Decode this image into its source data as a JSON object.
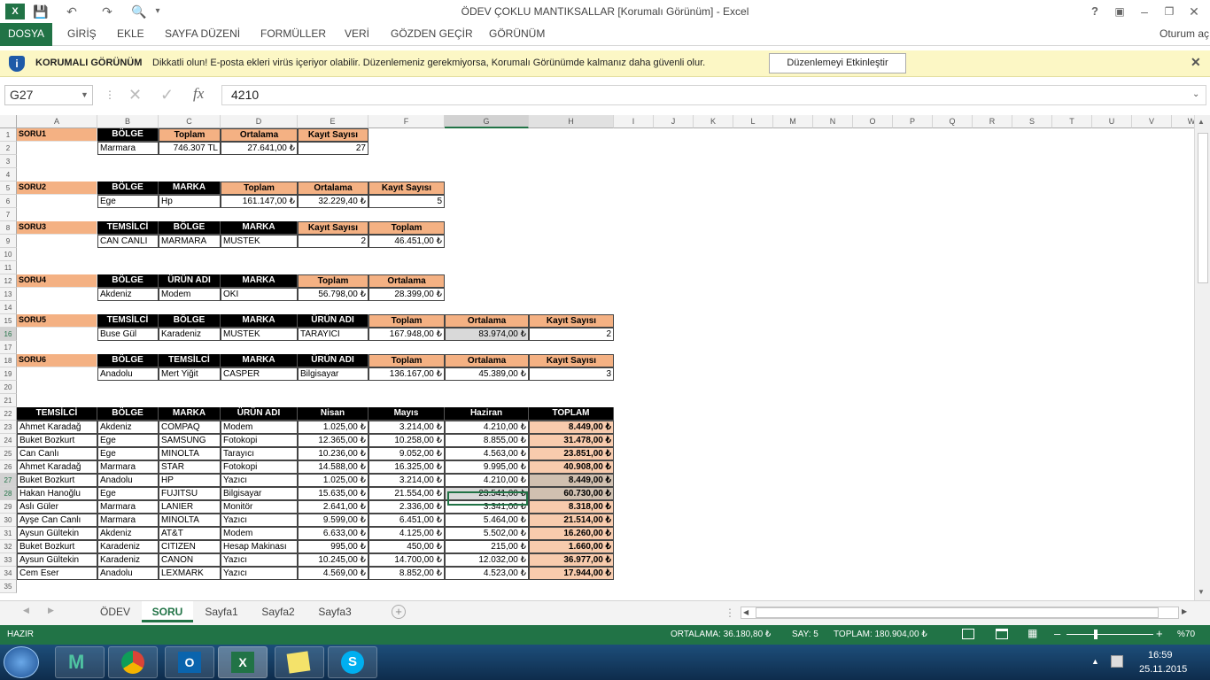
{
  "window": {
    "title": "ÖDEV ÇOKLU MANTIKSALLAR  [Korumalı Görünüm] - Excel",
    "help": "?",
    "signin": "Oturum aç"
  },
  "ribbon": {
    "tabs": [
      "DOSYA",
      "GİRİŞ",
      "EKLE",
      "SAYFA DÜZENİ",
      "FORMÜLLER",
      "VERİ",
      "GÖZDEN GEÇİR",
      "GÖRÜNÜM"
    ]
  },
  "protected": {
    "heading": "KORUMALI GÖRÜNÜM",
    "message": "Dikkatli olun! E-posta ekleri virüs içeriyor olabilir. Düzenlemeniz gerekmiyorsa, Korumalı Görünümde kalmanız daha güvenli olur.",
    "button": "Düzenlemeyi Etkinleştir"
  },
  "formula": {
    "namebox": "G27",
    "value": "4210"
  },
  "columns": [
    "A",
    "B",
    "C",
    "D",
    "E",
    "F",
    "G",
    "H",
    "I",
    "J",
    "K",
    "L",
    "M",
    "N",
    "O",
    "P",
    "Q",
    "R",
    "S",
    "T",
    "U",
    "V",
    "W"
  ],
  "rows": [
    "1",
    "2",
    "3",
    "4",
    "5",
    "6",
    "7",
    "8",
    "9",
    "10",
    "11",
    "12",
    "13",
    "14",
    "15",
    "16",
    "17",
    "18",
    "19",
    "20",
    "21",
    "22",
    "23",
    "24",
    "25",
    "26",
    "27",
    "28",
    "29",
    "30",
    "31",
    "32",
    "33",
    "34",
    "35"
  ],
  "cells": [
    [
      "A1",
      "SORU1",
      "lbl"
    ],
    [
      "B1",
      "BÖLGE",
      "hb"
    ],
    [
      "C1",
      "Toplam",
      "ho"
    ],
    [
      "D1",
      "Ortalama",
      "ho"
    ],
    [
      "E1",
      "Kayıt Sayısı",
      "ho"
    ],
    [
      "B2",
      "Marmara",
      "d"
    ],
    [
      "C2",
      "746.307 TL",
      "d r"
    ],
    [
      "D2",
      "27.641,00 ₺",
      "d r"
    ],
    [
      "E2",
      "27",
      "d r"
    ],
    [
      "A5",
      "SORU2",
      "lbl"
    ],
    [
      "B5",
      "BÖLGE",
      "hb"
    ],
    [
      "C5",
      "MARKA",
      "hb"
    ],
    [
      "D5",
      "Toplam",
      "ho"
    ],
    [
      "E5",
      "Ortalama",
      "ho"
    ],
    [
      "F5",
      "Kayıt Sayısı",
      "ho"
    ],
    [
      "B6",
      "Ege",
      "d"
    ],
    [
      "C6",
      "Hp",
      "d"
    ],
    [
      "D6",
      "161.147,00 ₺",
      "d r"
    ],
    [
      "E6",
      "32.229,40 ₺",
      "d r"
    ],
    [
      "F6",
      "5",
      "d r"
    ],
    [
      "A8",
      "SORU3",
      "lbl"
    ],
    [
      "B8",
      "TEMSİLCİ",
      "hb"
    ],
    [
      "C8",
      "BÖLGE",
      "hb"
    ],
    [
      "D8",
      "MARKA",
      "hb"
    ],
    [
      "E8",
      "Kayıt Sayısı",
      "ho"
    ],
    [
      "F8",
      "Toplam",
      "ho"
    ],
    [
      "B9",
      "CAN CANLI",
      "d"
    ],
    [
      "C9",
      "MARMARA",
      "d"
    ],
    [
      "D9",
      "MUSTEK",
      "d"
    ],
    [
      "E9",
      "2",
      "d r"
    ],
    [
      "F9",
      "46.451,00 ₺",
      "d r"
    ],
    [
      "A12",
      "SORU4",
      "lbl"
    ],
    [
      "B12",
      "BÖLGE",
      "hb"
    ],
    [
      "C12",
      "ÜRÜN ADI",
      "hb"
    ],
    [
      "D12",
      "MARKA",
      "hb"
    ],
    [
      "E12",
      "Toplam",
      "ho"
    ],
    [
      "F12",
      "Ortalama",
      "ho"
    ],
    [
      "B13",
      "Akdeniz",
      "d"
    ],
    [
      "C13",
      "Modem",
      "d"
    ],
    [
      "D13",
      "OKI",
      "d"
    ],
    [
      "E13",
      "56.798,00 ₺",
      "d r"
    ],
    [
      "F13",
      "28.399,00 ₺",
      "d r"
    ],
    [
      "A15",
      "SORU5",
      "lbl"
    ],
    [
      "B15",
      "TEMSİLCİ",
      "hb"
    ],
    [
      "C15",
      "BÖLGE",
      "hb"
    ],
    [
      "D15",
      "MARKA",
      "hb"
    ],
    [
      "E15",
      "ÜRÜN ADI",
      "hb"
    ],
    [
      "F15",
      "Toplam",
      "ho"
    ],
    [
      "G15",
      "Ortalama",
      "ho"
    ],
    [
      "H15",
      "Kayıt Sayısı",
      "ho"
    ],
    [
      "B16",
      "Buse Gül",
      "d"
    ],
    [
      "C16",
      "Karadeniz",
      "d"
    ],
    [
      "D16",
      "MUSTEK",
      "d"
    ],
    [
      "E16",
      "TARAYICI",
      "d"
    ],
    [
      "F16",
      "167.948,00 ₺",
      "d r"
    ],
    [
      "G16",
      "83.974,00 ₺",
      "d r sel"
    ],
    [
      "H16",
      "2",
      "d r"
    ],
    [
      "A18",
      "SORU6",
      "lbl"
    ],
    [
      "B18",
      "BÖLGE",
      "hb"
    ],
    [
      "C18",
      "TEMSİLCİ",
      "hb"
    ],
    [
      "D18",
      "MARKA",
      "hb"
    ],
    [
      "E18",
      "ÜRÜN ADI",
      "hb"
    ],
    [
      "F18",
      "Toplam",
      "ho"
    ],
    [
      "G18",
      "Ortalama",
      "ho"
    ],
    [
      "H18",
      "Kayıt Sayısı",
      "ho"
    ],
    [
      "B19",
      "Anadolu",
      "d"
    ],
    [
      "C19",
      "Mert Yiğit",
      "d"
    ],
    [
      "D19",
      "CASPER",
      "d"
    ],
    [
      "E19",
      "Bilgisayar",
      "d"
    ],
    [
      "F19",
      "136.167,00 ₺",
      "d r"
    ],
    [
      "G19",
      "45.389,00 ₺",
      "d r"
    ],
    [
      "H19",
      "3",
      "d r"
    ],
    [
      "A22",
      "TEMSİLCİ",
      "hb"
    ],
    [
      "B22",
      "BÖLGE",
      "hb"
    ],
    [
      "C22",
      "MARKA",
      "hb"
    ],
    [
      "D22",
      "ÜRÜN ADI",
      "hb"
    ],
    [
      "E22",
      "Nisan",
      "hb"
    ],
    [
      "F22",
      "Mayıs",
      "hb"
    ],
    [
      "G22",
      "Haziran",
      "hb"
    ],
    [
      "H22",
      "TOPLAM",
      "hb"
    ],
    [
      "A23",
      "Ahmet Karadağ",
      "d"
    ],
    [
      "B23",
      "Akdeniz",
      "d"
    ],
    [
      "C23",
      "COMPAQ",
      "d"
    ],
    [
      "D23",
      "Modem",
      "d"
    ],
    [
      "E23",
      "1.025,00 ₺",
      "d r"
    ],
    [
      "F23",
      "3.214,00 ₺",
      "d r"
    ],
    [
      "G23",
      "4.210,00 ₺",
      "d r"
    ],
    [
      "H23",
      "8.449,00 ₺",
      "d tot"
    ],
    [
      "A24",
      "Buket Bozkurt",
      "d"
    ],
    [
      "B24",
      "Ege",
      "d"
    ],
    [
      "C24",
      "SAMSUNG",
      "d"
    ],
    [
      "D24",
      "Fotokopi",
      "d"
    ],
    [
      "E24",
      "12.365,00 ₺",
      "d r"
    ],
    [
      "F24",
      "10.258,00 ₺",
      "d r"
    ],
    [
      "G24",
      "8.855,00 ₺",
      "d r"
    ],
    [
      "H24",
      "31.478,00 ₺",
      "d tot"
    ],
    [
      "A25",
      "Can Canlı",
      "d"
    ],
    [
      "B25",
      "Ege",
      "d"
    ],
    [
      "C25",
      "MINOLTA",
      "d"
    ],
    [
      "D25",
      "Tarayıcı",
      "d"
    ],
    [
      "E25",
      "10.236,00 ₺",
      "d r"
    ],
    [
      "F25",
      "9.052,00 ₺",
      "d r"
    ],
    [
      "G25",
      "4.563,00 ₺",
      "d r"
    ],
    [
      "H25",
      "23.851,00 ₺",
      "d tot"
    ],
    [
      "A26",
      "Ahmet Karadağ",
      "d"
    ],
    [
      "B26",
      "Marmara",
      "d"
    ],
    [
      "C26",
      "STAR",
      "d"
    ],
    [
      "D26",
      "Fotokopi",
      "d"
    ],
    [
      "E26",
      "14.588,00 ₺",
      "d r"
    ],
    [
      "F26",
      "16.325,00 ₺",
      "d r"
    ],
    [
      "G26",
      "9.995,00 ₺",
      "d r"
    ],
    [
      "H26",
      "40.908,00 ₺",
      "d tot"
    ],
    [
      "A27",
      "Buket Bozkurt",
      "d"
    ],
    [
      "B27",
      "Anadolu",
      "d"
    ],
    [
      "C27",
      "HP",
      "d"
    ],
    [
      "D27",
      "Yazıcı",
      "d"
    ],
    [
      "E27",
      "1.025,00 ₺",
      "d r"
    ],
    [
      "F27",
      "3.214,00 ₺",
      "d r"
    ],
    [
      "G27",
      "4.210,00 ₺",
      "d r"
    ],
    [
      "H27",
      "8.449,00 ₺",
      "d tot sel2"
    ],
    [
      "A28",
      "Hakan Hanoğlu",
      "d"
    ],
    [
      "B28",
      "Ege",
      "d"
    ],
    [
      "C28",
      "FUJITSU",
      "d"
    ],
    [
      "D28",
      "Bilgisayar",
      "d"
    ],
    [
      "E28",
      "15.635,00 ₺",
      "d r"
    ],
    [
      "F28",
      "21.554,00 ₺",
      "d r"
    ],
    [
      "G28",
      "23.541,00 ₺",
      "d r sel"
    ],
    [
      "H28",
      "60.730,00 ₺",
      "d tot sel2"
    ],
    [
      "A29",
      "Aslı Güler",
      "d"
    ],
    [
      "B29",
      "Marmara",
      "d"
    ],
    [
      "C29",
      "LANIER",
      "d"
    ],
    [
      "D29",
      "Monitör",
      "d"
    ],
    [
      "E29",
      "2.641,00 ₺",
      "d r"
    ],
    [
      "F29",
      "2.336,00 ₺",
      "d r"
    ],
    [
      "G29",
      "3.341,00 ₺",
      "d r"
    ],
    [
      "H29",
      "8.318,00 ₺",
      "d tot"
    ],
    [
      "A30",
      "Ayşe Can Canlı",
      "d"
    ],
    [
      "B30",
      "Marmara",
      "d"
    ],
    [
      "C30",
      "MINOLTA",
      "d"
    ],
    [
      "D30",
      "Yazıcı",
      "d"
    ],
    [
      "E30",
      "9.599,00 ₺",
      "d r"
    ],
    [
      "F30",
      "6.451,00 ₺",
      "d r"
    ],
    [
      "G30",
      "5.464,00 ₺",
      "d r"
    ],
    [
      "H30",
      "21.514,00 ₺",
      "d tot"
    ],
    [
      "A31",
      "Aysun Gültekin",
      "d"
    ],
    [
      "B31",
      "Akdeniz",
      "d"
    ],
    [
      "C31",
      "AT&T",
      "d"
    ],
    [
      "D31",
      "Modem",
      "d"
    ],
    [
      "E31",
      "6.633,00 ₺",
      "d r"
    ],
    [
      "F31",
      "4.125,00 ₺",
      "d r"
    ],
    [
      "G31",
      "5.502,00 ₺",
      "d r"
    ],
    [
      "H31",
      "16.260,00 ₺",
      "d tot"
    ],
    [
      "A32",
      "Buket Bozkurt",
      "d"
    ],
    [
      "B32",
      "Karadeniz",
      "d"
    ],
    [
      "C32",
      "CITIZEN",
      "d"
    ],
    [
      "D32",
      "Hesap Makinası",
      "d"
    ],
    [
      "E32",
      "995,00 ₺",
      "d r"
    ],
    [
      "F32",
      "450,00 ₺",
      "d r"
    ],
    [
      "G32",
      "215,00 ₺",
      "d r"
    ],
    [
      "H32",
      "1.660,00 ₺",
      "d tot"
    ],
    [
      "A33",
      "Aysun Gültekin",
      "d"
    ],
    [
      "B33",
      "Karadeniz",
      "d"
    ],
    [
      "C33",
      "CANON",
      "d"
    ],
    [
      "D33",
      "Yazıcı",
      "d"
    ],
    [
      "E33",
      "10.245,00 ₺",
      "d r"
    ],
    [
      "F33",
      "14.700,00 ₺",
      "d r"
    ],
    [
      "G33",
      "12.032,00 ₺",
      "d r"
    ],
    [
      "H33",
      "36.977,00 ₺",
      "d tot"
    ],
    [
      "A34",
      "Cem Eser",
      "d"
    ],
    [
      "B34",
      "Anadolu",
      "d"
    ],
    [
      "C34",
      "LEXMARK",
      "d"
    ],
    [
      "D34",
      "Yazıcı",
      "d"
    ],
    [
      "E34",
      "4.569,00 ₺",
      "d r"
    ],
    [
      "F34",
      "8.852,00 ₺",
      "d r"
    ],
    [
      "G34",
      "4.523,00 ₺",
      "d r"
    ],
    [
      "H34",
      "17.944,00 ₺",
      "d tot"
    ]
  ],
  "sheets": [
    "ÖDEV",
    "SORU",
    "Sayfa1",
    "Sayfa2",
    "Sayfa3"
  ],
  "status": {
    "ready": "HAZIR",
    "average": "ORTALAMA:  36.180,80 ₺",
    "count": "SAY: 5",
    "sum": "TOPLAM:  180.904,00 ₺",
    "zoom": "%70"
  },
  "taskbar": {
    "time": "16:59",
    "date": "25.11.2015"
  },
  "colors": {
    "excel_green": "#217346",
    "orange_header": "#f4b183",
    "protected_bar": "#fcf7c5"
  }
}
